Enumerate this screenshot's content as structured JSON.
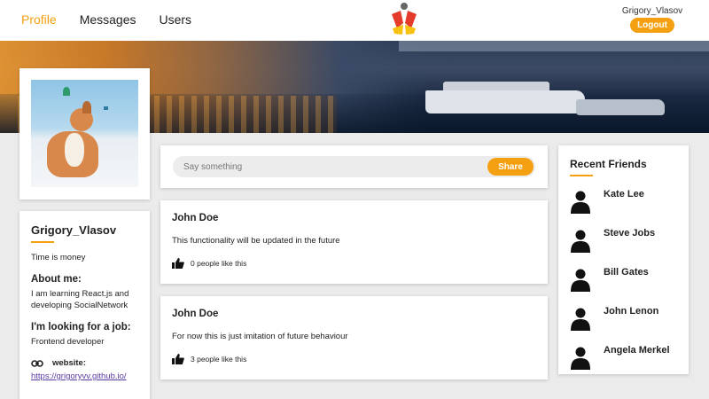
{
  "header": {
    "nav": [
      {
        "label": "Profile",
        "active": true
      },
      {
        "label": "Messages",
        "active": false
      },
      {
        "label": "Users",
        "active": false
      }
    ],
    "username": "Grigory_Vlasov",
    "logout_label": "Logout"
  },
  "colors": {
    "accent": "#f5a011",
    "background": "#ebebeb",
    "link": "#5a3aa5"
  },
  "profile": {
    "name": "Grigory_Vlasov",
    "status": "Time is money",
    "about_heading": "About me:",
    "about_text": "I am learning React.js and developing SocialNetwork",
    "job_heading": "I'm looking for a job:",
    "job_text": "Frontend developer",
    "contact_label": "website:",
    "contact_url": "https://grigoryvv.github.io/"
  },
  "post_form": {
    "placeholder": "Say something",
    "share_label": "Share"
  },
  "posts": [
    {
      "author": "John Doe",
      "text": "This functionality will be updated in the future",
      "likes": "0 people like this"
    },
    {
      "author": "John Doe",
      "text": "For now this is just imitation of future behaviour",
      "likes": "3 people like this"
    }
  ],
  "friends": {
    "title": "Recent Friends",
    "items": [
      {
        "name": "Kate Lee"
      },
      {
        "name": "Steve Jobs"
      },
      {
        "name": "Bill Gates"
      },
      {
        "name": "John Lenon"
      },
      {
        "name": "Angela Merkel"
      }
    ]
  }
}
